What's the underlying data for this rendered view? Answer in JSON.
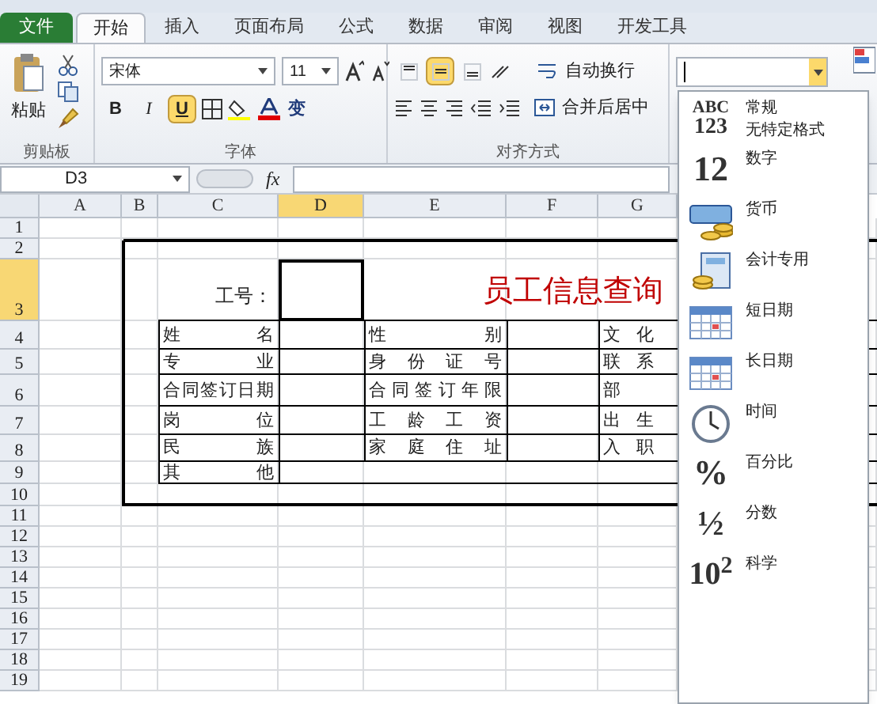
{
  "tabs": [
    {
      "label": "文件",
      "kind": "file",
      "selected": false
    },
    {
      "label": "开始",
      "kind": "tab",
      "selected": true
    },
    {
      "label": "插入",
      "kind": "tab",
      "selected": false
    },
    {
      "label": "页面布局",
      "kind": "tab",
      "selected": false
    },
    {
      "label": "公式",
      "kind": "tab",
      "selected": false
    },
    {
      "label": "数据",
      "kind": "tab",
      "selected": false
    },
    {
      "label": "审阅",
      "kind": "tab",
      "selected": false
    },
    {
      "label": "视图",
      "kind": "tab",
      "selected": false
    },
    {
      "label": "开发工具",
      "kind": "tab",
      "selected": false
    }
  ],
  "ribbon": {
    "clipboard": {
      "label": "剪贴板",
      "paste": "粘贴"
    },
    "font": {
      "label": "字体",
      "name": "宋体",
      "size": "11",
      "styles": [
        {
          "kind": "bold",
          "label": "B",
          "on": false
        },
        {
          "kind": "italic",
          "label": "I",
          "on": false
        },
        {
          "kind": "underline",
          "label": "U",
          "on": true
        }
      ],
      "phonetic": "变"
    },
    "alignment": {
      "label": "对齐方式",
      "vertical": [
        {
          "kind": "top",
          "on": false
        },
        {
          "kind": "middle",
          "on": true
        },
        {
          "kind": "bottom",
          "on": false
        }
      ],
      "wrap": "自动换行",
      "merge": "合并后居中"
    },
    "number_format": {
      "expanded": true
    }
  },
  "formula_bar": {
    "name_box": "D3",
    "function_label": "fx"
  },
  "sheet": {
    "columns": [
      {
        "label": "A",
        "selected": false
      },
      {
        "label": "B",
        "selected": false
      },
      {
        "label": "C",
        "selected": false
      },
      {
        "label": "D",
        "selected": true
      },
      {
        "label": "E",
        "selected": false
      },
      {
        "label": "F",
        "selected": false
      },
      {
        "label": "G",
        "selected": false
      }
    ],
    "rows": [
      {
        "label": "1",
        "selected": false
      },
      {
        "label": "2",
        "selected": false
      },
      {
        "label": "3",
        "selected": true
      },
      {
        "label": "4",
        "selected": false
      },
      {
        "label": "5",
        "selected": false
      },
      {
        "label": "6",
        "selected": false
      },
      {
        "label": "7",
        "selected": false
      },
      {
        "label": "8",
        "selected": false
      },
      {
        "label": "9",
        "selected": false
      },
      {
        "label": "10",
        "selected": false
      },
      {
        "label": "11",
        "selected": false
      },
      {
        "label": "12",
        "selected": false
      },
      {
        "label": "13",
        "selected": false
      },
      {
        "label": "14",
        "selected": false
      },
      {
        "label": "15",
        "selected": false
      },
      {
        "label": "16",
        "selected": false
      },
      {
        "label": "17",
        "selected": false
      },
      {
        "label": "18",
        "selected": false
      },
      {
        "label": "19",
        "selected": false
      }
    ],
    "form": {
      "id_label": "工号：",
      "title": "员工信息查询",
      "fields": [
        {
          "left": "姓名",
          "middle": "性别",
          "right": "文化"
        },
        {
          "left": "专业",
          "middle": "身份证号",
          "right": "联系"
        },
        {
          "left": "合同签订日期",
          "middle": "合同签订年限",
          "right": "部"
        },
        {
          "left": "岗位",
          "middle": "工龄工资",
          "right": "出生"
        },
        {
          "left": "民族",
          "middle": "家庭住址",
          "right": "入职"
        }
      ],
      "other": "其他"
    }
  },
  "format_menu": {
    "items": [
      {
        "kind": "general",
        "icon_text": "ABC",
        "icon_sub": "123",
        "label": "常规",
        "description": "无特定格式"
      },
      {
        "kind": "number",
        "icon_text": "12",
        "label": "数字"
      },
      {
        "kind": "currency",
        "label": "货币"
      },
      {
        "kind": "accounting",
        "label": "会计专用"
      },
      {
        "kind": "short_date",
        "label": "短日期"
      },
      {
        "kind": "long_date",
        "label": "长日期"
      },
      {
        "kind": "time",
        "label": "时间"
      },
      {
        "kind": "percent",
        "icon_text": "%",
        "label": "百分比"
      },
      {
        "kind": "fraction",
        "icon_text": "½",
        "label": "分数"
      },
      {
        "kind": "scientific",
        "icon_text": "10$^{2}$",
        "label": "科学"
      }
    ]
  }
}
